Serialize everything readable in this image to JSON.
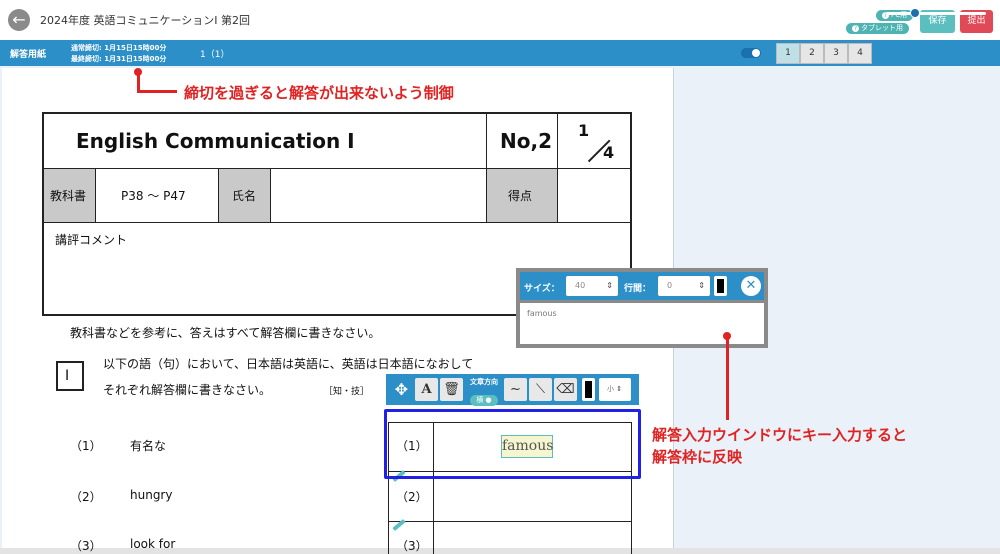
{
  "header": {
    "back_icon": "arrow-left-icon",
    "title": "2024年度 英語コミュニケーションⅠ 第2回",
    "mode_pc": "PC用",
    "mode_tablet": "タブレット用",
    "save_label": "保存",
    "submit_label": "提出"
  },
  "toolbar": {
    "sheet_label": "解答用紙",
    "deadline_normal": "通常締切: 1月15日15時00分",
    "deadline_final": "最終締切: 1月31日15時00分",
    "page_indicator": "1（1）",
    "pages": [
      "1",
      "2",
      "3",
      "4"
    ],
    "active_page": "1"
  },
  "annotations": {
    "deadline_note": "締切を過ぎると解答が出来ないよう制御",
    "input_note_line1": "解答入力ウインドウにキー入力すると",
    "input_note_line2": "解答枠に反映"
  },
  "worksheet": {
    "title": "English Communication Ⅰ",
    "number": "No,2",
    "fraction_top": "1",
    "fraction_bottom": "4",
    "textbook_label": "教科書",
    "pages": "P38 〜 P47",
    "name_label": "氏名",
    "score_label": "得点",
    "comment_label": "講評コメント",
    "instruction": "教科書などを参考に、答えはすべて解答欄に書きなさい。",
    "section_number": "Ⅰ",
    "section_text_line1": "以下の語（句）において、日本語は英語に、英語は日本語になおして",
    "section_text_line2": "それぞれ解答欄に書きなさい。",
    "section_tag": "［知・技］",
    "questions": [
      {
        "num": "（1）",
        "text": "有名な"
      },
      {
        "num": "（2）",
        "text": "hungry"
      },
      {
        "num": "（3）",
        "text": "look for"
      }
    ],
    "answer_rows": [
      {
        "num": "（1）",
        "answer": "famous"
      },
      {
        "num": "（2）",
        "answer": ""
      },
      {
        "num": "（3）",
        "answer": ""
      }
    ]
  },
  "input_window": {
    "size_label": "サイズ：",
    "size_value": "40",
    "line_spacing_label": "行間：",
    "line_spacing_value": "0",
    "text": "famous",
    "close_icon": "close-icon"
  },
  "draw_toolbar": {
    "move_icon": "move-icon",
    "text_icon": "A",
    "trash_icon": "trash-icon",
    "direction_label": "文章方向",
    "direction_value": "横",
    "pen_icon": "freehand-pen-icon",
    "line_icon": "line-icon",
    "eraser_icon": "eraser-icon",
    "size_value": "小"
  },
  "colors": {
    "accent_blue": "#2d8fc7",
    "teal": "#5bbfbf",
    "submit_red": "#e04a56",
    "annotation_red": "#e02222",
    "highlight_blue": "#2020e8"
  }
}
